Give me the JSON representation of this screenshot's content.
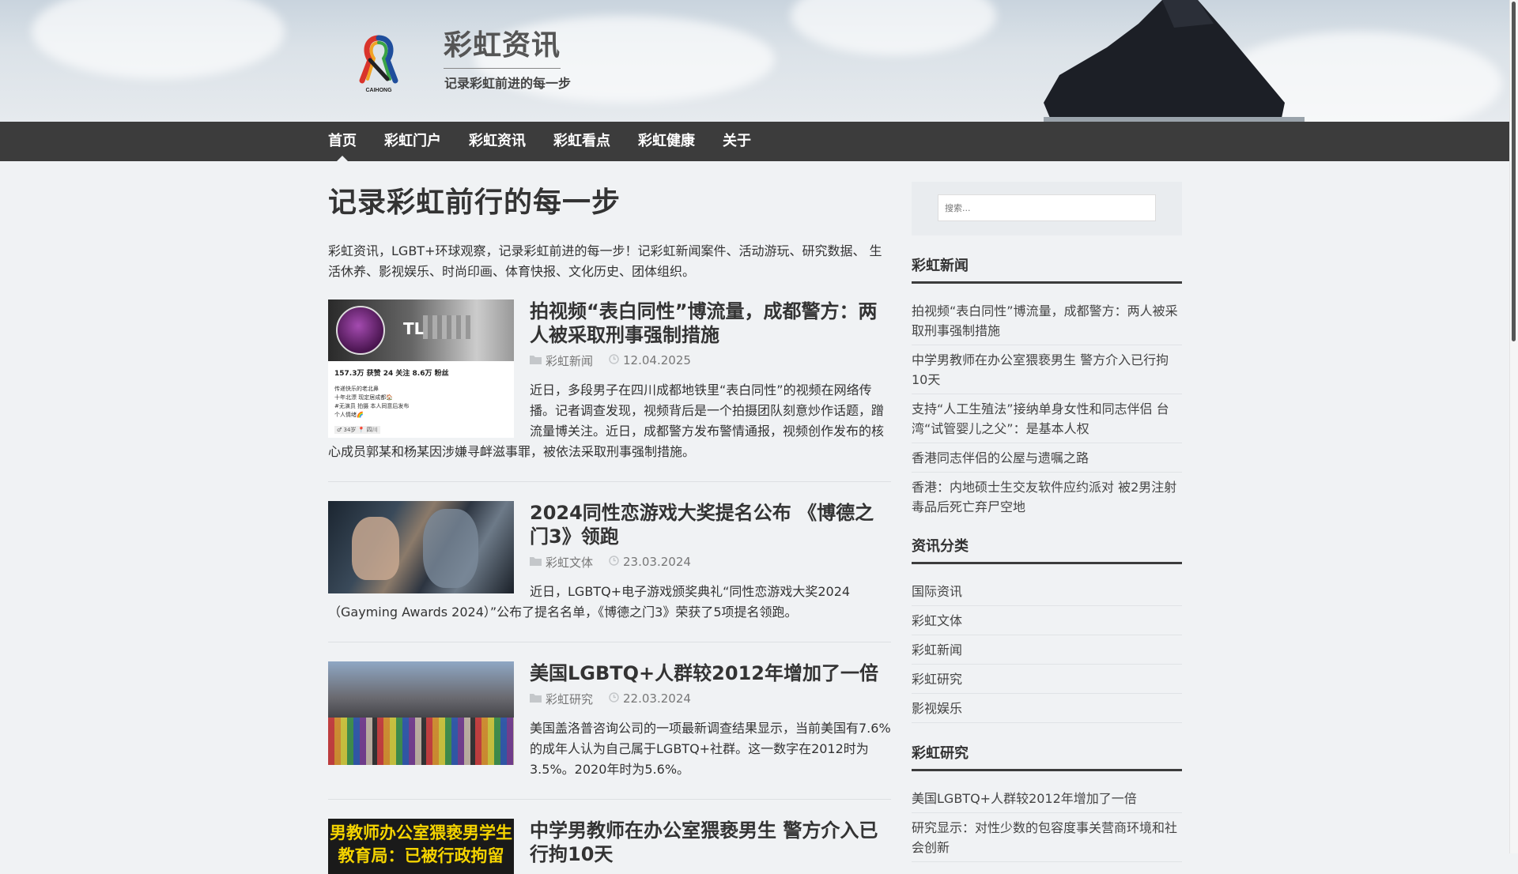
{
  "site": {
    "title": "彩虹资讯",
    "tagline": "记录彩虹前进的每一步",
    "logo_text": "CAIHONG"
  },
  "nav": {
    "items": [
      {
        "label": "首页",
        "active": true
      },
      {
        "label": "彩虹门户"
      },
      {
        "label": "彩虹资讯"
      },
      {
        "label": "彩虹看点"
      },
      {
        "label": "彩虹健康"
      },
      {
        "label": "关于"
      }
    ]
  },
  "main": {
    "page_title": "记录彩虹前行的每一步",
    "intro": "彩虹资讯，LGBT+环球观察，记录彩虹前进的每一步！记彩虹新闻案件、活动游玩、研究数据、 生活休养、影视娱乐、时尚印画、体育快报、文化历史、团体组织。",
    "posts": [
      {
        "title": "拍视频“表白同性”博流量，成都警方：两人被采取刑事强制措施",
        "category": "彩虹新闻",
        "date": "12.04.2025",
        "excerpt": "近日，多段男子在四川成都地铁里“表白同性”的视频在网络传播。记者调查发现，视频背后是一个拍摄团队刻意炒作话题，蹭流量博关注。近日，成都警方发布警情通报，视频创作发布的核心成员郭某和杨某因涉嫌寻衅滋事罪，被依法采取刑事强制措施。",
        "thumb": {
          "avatar_name": "TL",
          "stats": "157.3万 获赞   24 关注   8.6万 粉丝",
          "bio1": "传递快乐的老北鼻",
          "bio2": "十年北漂 现定居成都🏠",
          "bio3": "#无演员 拍摄 本人同意后发布",
          "bio4": "个人情绪🌈",
          "tag": "♂ 34岁   📍 四川"
        }
      },
      {
        "title": "2024同性恋游戏大奖提名公布 《博德之门3》领跑",
        "category": "彩虹文体",
        "date": "23.03.2024",
        "excerpt": "近日，LGBTQ+电子游戏颁奖典礼“同性恋游戏大奖2024（Gayming Awards 2024）”公布了提名名单，《博德之门3》荣获了5项提名领跑。"
      },
      {
        "title": "美国LGBTQ+人群较2012年增加了一倍",
        "category": "彩虹研究",
        "date": "22.03.2024",
        "excerpt": "美国盖洛普咨询公司的一项最新调查结果显示，当前美国有7.6%的成年人认为自己属于LGBTQ+社群。这一数字在2012时为3.5%。2020年时为5.6%。"
      },
      {
        "title": "中学男教师在办公室猥亵男生 警方介入已行拘10天",
        "category": "",
        "date": "",
        "excerpt": "",
        "thumb": {
          "line1": "男教师办公室猥亵男学生",
          "line2": "教育局：已被行政拘留"
        }
      }
    ]
  },
  "sidebar": {
    "search": {
      "placeholder": "搜索..."
    },
    "widgets": [
      {
        "title": "彩虹新闻",
        "items": [
          "拍视频“表白同性”博流量，成都警方：两人被采取刑事强制措施",
          "中学男教师在办公室猥亵男生 警方介入已行拘10天",
          "支持“人工生殖法”接纳单身女性和同志伴侣 台湾“试管婴儿之父”：是基本人权",
          "香港同志伴侣的公屋与遗嘱之路",
          "香港：内地硕士生交友软件应约派对 被2男注射毒品后死亡弃尸空地"
        ]
      },
      {
        "title": "资讯分类",
        "items": [
          "国际资讯",
          "彩虹文体",
          "彩虹新闻",
          "彩虹研究",
          "影视娱乐"
        ]
      },
      {
        "title": "彩虹研究",
        "items": [
          "美国LGBTQ+人群较2012年增加了一倍",
          "研究显示：对性少数的包容度事关营商环境和社会创新"
        ]
      }
    ]
  },
  "colors": {
    "nav_bg": "#3c3c3c",
    "page_bg": "#f0f2f4",
    "text": "#333333"
  }
}
